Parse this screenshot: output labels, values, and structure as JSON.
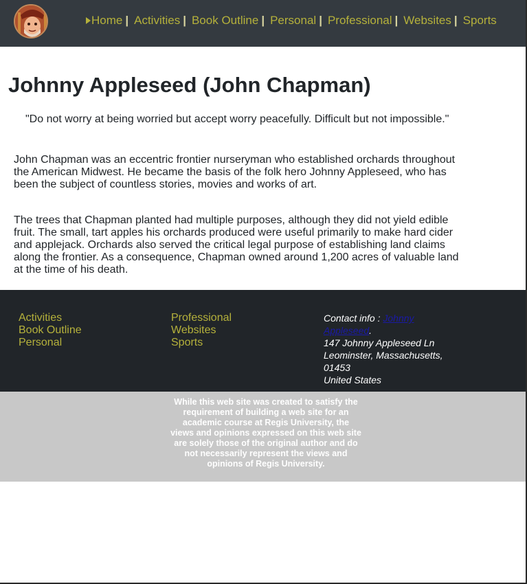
{
  "nav": {
    "items": [
      {
        "label": "Home",
        "active": true
      },
      {
        "label": "Activities"
      },
      {
        "label": "Book Outline"
      },
      {
        "label": "Personal"
      },
      {
        "label": "Professional"
      },
      {
        "label": "Websites"
      },
      {
        "label": "Sports"
      }
    ],
    "separator": "|"
  },
  "main": {
    "title": "Johnny Appleseed (John Chapman)",
    "quote": "\"Do not worry at being worried but accept worry peacefully. Difficult but not impossible.\"",
    "paragraphs": [
      "John Chapman was an eccentric frontier nurseryman who established orchards throughout the American Midwest. He became the basis of the folk hero Johnny Appleseed, who has been the subject of countless stories, movies and works of art.",
      "The trees that Chapman planted had multiple purposes, although they did not yield edible fruit. The small, tart apples his orchards produced were useful primarily to make hard cider and applejack. Orchards also served the critical legal purpose of establishing land claims along the frontier. As a consequence, Chapman owned around 1,200 acres of valuable land at the time of his death."
    ]
  },
  "footer": {
    "col1": [
      "Activities",
      "Book Outline",
      "Personal"
    ],
    "col2": [
      "Professional",
      "Websites",
      "Sports"
    ],
    "contact": {
      "label": "Contact info : ",
      "link": "Johnny Appleseed",
      "after_link": ".",
      "address1": "147 Johnny Appleseed Ln",
      "address2": "Leominster, Massachusetts, 01453",
      "country": "United States"
    },
    "disclaimer": "While this web site was created to satisfy the requirement of building a web site for an academic course at Regis University, the views and opinions expressed on this web site are solely those of the original author and do not necessarily represent the views and opinions of Regis University."
  },
  "colors": {
    "header_bg": "#343a40",
    "footer_bg": "#212529",
    "link": "#b5b13b",
    "disclaimer_bg": "#c8c8c8"
  },
  "icons": {
    "logo": "portrait-logo",
    "active_marker": "triangle-right-icon"
  }
}
